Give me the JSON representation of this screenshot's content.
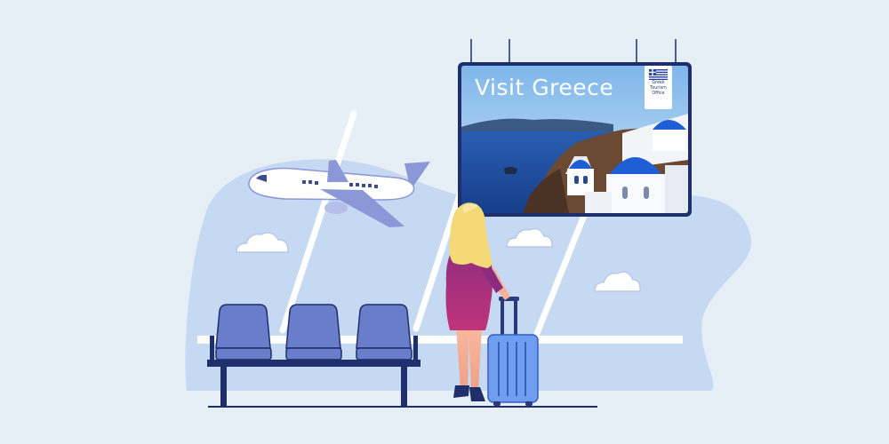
{
  "billboard": {
    "title": "Visit Greece",
    "badge_lines": [
      "Greek",
      "Tourism",
      "Office"
    ]
  },
  "colors": {
    "background": "#e6eff6",
    "window_blob": "#c6d9f3",
    "frame": "#ffffff",
    "bench": "#1e2f6b",
    "seat": "#6a7dcb",
    "suitcase": "#6f9ef0",
    "dress": "#8a2a7a",
    "hair": "#f5d978",
    "sea": "#1f4fa3",
    "sky": "#a9cff2",
    "dome": "#1f5fd6"
  }
}
